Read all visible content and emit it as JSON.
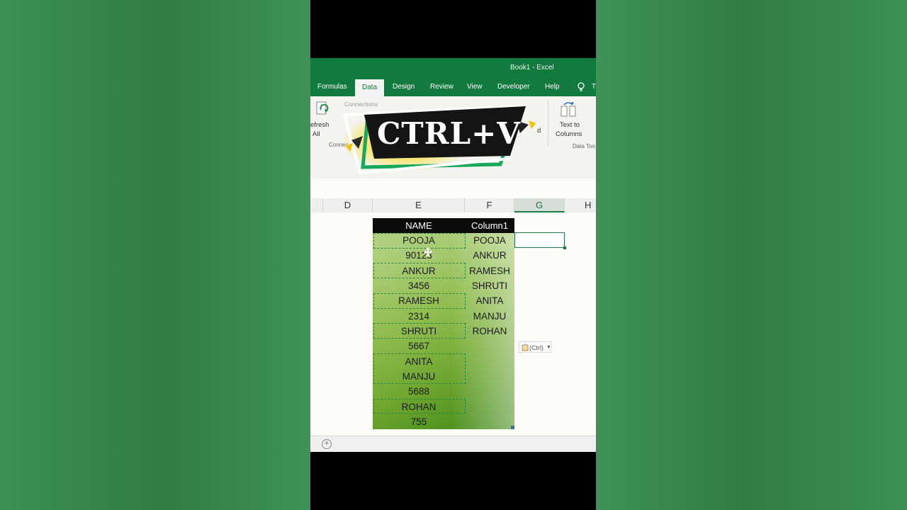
{
  "window": {
    "title": "Book1  -  Excel"
  },
  "tabs": [
    {
      "label": "Formulas",
      "active": false
    },
    {
      "label": "Data",
      "active": true
    },
    {
      "label": "Design",
      "active": false
    },
    {
      "label": "Review",
      "active": false
    },
    {
      "label": "View",
      "active": false
    },
    {
      "label": "Developer",
      "active": false
    },
    {
      "label": "Help",
      "active": false
    }
  ],
  "tell_me_partial": "T",
  "ribbon": {
    "refresh_label_1": "efresh",
    "refresh_label_2": "All",
    "connections_label": "Connections",
    "connections_group": "Connec",
    "text_to_columns_1": "Text to",
    "text_to_columns_2": "Columns",
    "data_tools_group": "Data Too",
    "partial_label": "d"
  },
  "overlay": {
    "shortcut": "CTRL+V"
  },
  "columns": [
    "D",
    "E",
    "F",
    "G",
    "H"
  ],
  "selected_column": "G",
  "table": {
    "headers": [
      "NAME",
      "Column1"
    ],
    "name_column": [
      "POOJA",
      "90123",
      "ANKUR",
      "3456",
      "RAMESH",
      "2314",
      "SHRUTI",
      "5667",
      "ANITA",
      "MANJU",
      "5688",
      "ROHAN",
      "755"
    ],
    "column1": [
      "POOJA",
      "ANKUR",
      "RAMESH",
      "SHRUTI",
      "ANITA",
      "MANJU",
      "ROHAN"
    ]
  },
  "paste_options": {
    "label": "(Ctrl)"
  },
  "colors": {
    "excel_green": "#127a3e",
    "accent_green": "#217346"
  }
}
